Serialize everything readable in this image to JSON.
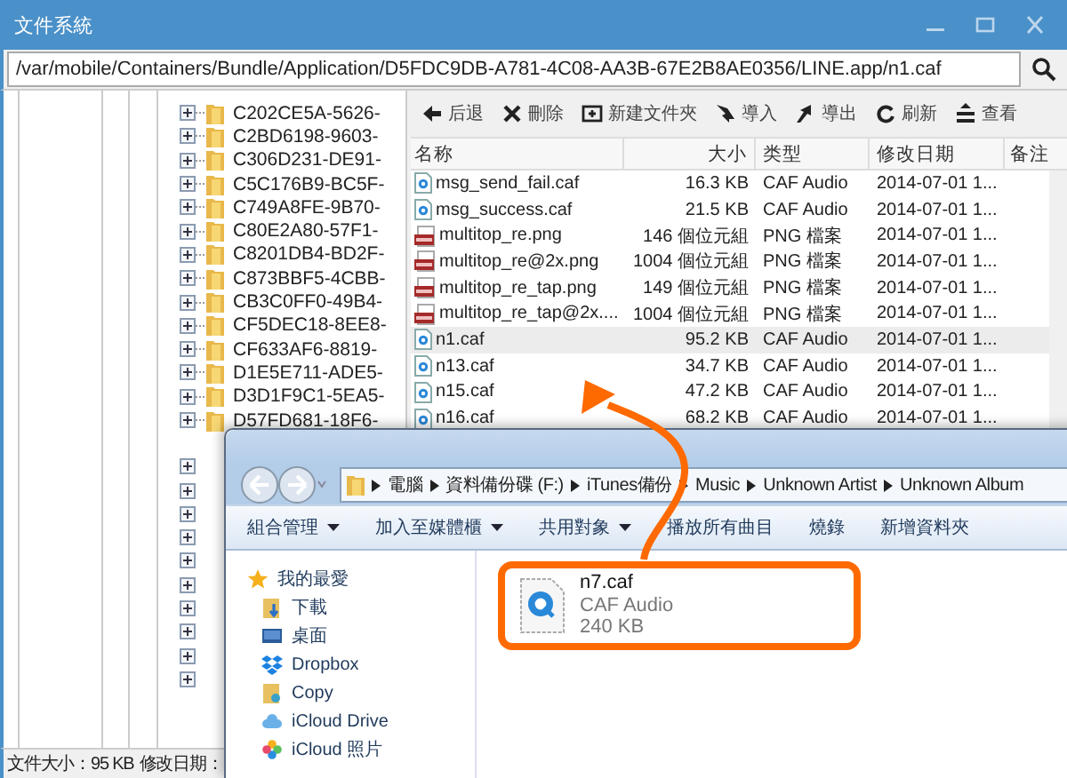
{
  "window": {
    "title": "文件系統"
  },
  "path": {
    "value": "/var/mobile/Containers/Bundle/Application/D5FDC9DB-A781-4C08-AA3B-67E2B8AE0356/LINE.app/n1.caf"
  },
  "tree": {
    "items": [
      {
        "label": "C202CE5A-5626-",
        "expanded": false
      },
      {
        "label": "C2BD6198-9603-",
        "expanded": false
      },
      {
        "label": "C306D231-DE91-",
        "expanded": false
      },
      {
        "label": "C5C176B9-BC5F-",
        "expanded": false
      },
      {
        "label": "C749A8FE-9B70-",
        "expanded": false
      },
      {
        "label": "C80E2A80-57F1-",
        "expanded": false
      },
      {
        "label": "C8201DB4-BD2F-",
        "expanded": false
      },
      {
        "label": "C873BBF5-4CBB-",
        "expanded": false
      },
      {
        "label": "CB3C0FF0-49B4-",
        "expanded": false
      },
      {
        "label": "CF5DEC18-8EE8-",
        "expanded": false
      },
      {
        "label": "CF633AF6-8819-",
        "expanded": false
      },
      {
        "label": "D1E5E711-ADE5-",
        "expanded": false
      },
      {
        "label": "D3D1F9C1-5EA5-",
        "expanded": false
      },
      {
        "label": "D57FD681-18F6-",
        "expanded": false
      }
    ]
  },
  "toolbar": [
    {
      "label": "后退",
      "kind": "back"
    },
    {
      "label": "刪除",
      "kind": "delete"
    },
    {
      "label": "新建文件夾",
      "kind": "newfolder"
    },
    {
      "label": "導入",
      "kind": "import"
    },
    {
      "label": "導出",
      "kind": "export"
    },
    {
      "label": "刷新",
      "kind": "refresh"
    },
    {
      "label": "查看",
      "kind": "view"
    }
  ],
  "table": {
    "columns": [
      "名称",
      "大小",
      "类型",
      "修改日期",
      "备注"
    ],
    "rows": [
      {
        "name": "msg_send_fail.caf",
        "size": "16.3 KB",
        "type": "CAF Audio",
        "modified": "2014-07-01 1...",
        "kind": "audio",
        "selected": false
      },
      {
        "name": "msg_success.caf",
        "size": "21.5 KB",
        "type": "CAF Audio",
        "modified": "2014-07-01 1...",
        "kind": "audio",
        "selected": false
      },
      {
        "name": "multitop_re.png",
        "size": "146 個位元組",
        "type": "PNG 檔案",
        "modified": "2014-07-01 1...",
        "kind": "image",
        "selected": false
      },
      {
        "name": "multitop_re@2x.png",
        "size": "1004 個位元組",
        "type": "PNG 檔案",
        "modified": "2014-07-01 1...",
        "kind": "image",
        "selected": false
      },
      {
        "name": "multitop_re_tap.png",
        "size": "149 個位元組",
        "type": "PNG 檔案",
        "modified": "2014-07-01 1...",
        "kind": "image",
        "selected": false
      },
      {
        "name": "multitop_re_tap@2x....",
        "size": "1004 個位元組",
        "type": "PNG 檔案",
        "modified": "2014-07-01 1...",
        "kind": "image",
        "selected": false
      },
      {
        "name": "n1.caf",
        "size": "95.2 KB",
        "type": "CAF Audio",
        "modified": "2014-07-01 1...",
        "kind": "audio",
        "selected": true
      },
      {
        "name": "n13.caf",
        "size": "34.7 KB",
        "type": "CAF Audio",
        "modified": "2014-07-01 1...",
        "kind": "audio",
        "selected": false
      },
      {
        "name": "n15.caf",
        "size": "47.2 KB",
        "type": "CAF Audio",
        "modified": "2014-07-01 1...",
        "kind": "audio",
        "selected": false
      },
      {
        "name": "n16.caf",
        "size": "68.2 KB",
        "type": "CAF Audio",
        "modified": "2014-07-01 1...",
        "kind": "audio",
        "selected": false
      }
    ]
  },
  "status_bar": {
    "file_size": "文件大小：95 KB",
    "modified": "修改日期："
  },
  "explorer": {
    "breadcrumb": [
      "電腦",
      "資料備份碟 (F:)",
      "iTunes備份",
      "Music",
      "Unknown Artist",
      "Unknown Album"
    ],
    "toolbar": [
      {
        "label": "組合管理",
        "dropdown": true
      },
      {
        "label": "加入至媒體櫃",
        "dropdown": true
      },
      {
        "label": "共用對象",
        "dropdown": true
      },
      {
        "label": "播放所有曲目",
        "dropdown": false
      },
      {
        "label": "燒錄",
        "dropdown": false
      },
      {
        "label": "新增資料夾",
        "dropdown": false
      }
    ],
    "sidebar": [
      {
        "label": "我的最愛",
        "kind": "favorites"
      },
      {
        "label": "下載",
        "kind": "downloads"
      },
      {
        "label": "桌面",
        "kind": "desktop"
      },
      {
        "label": "Dropbox",
        "kind": "dropbox"
      },
      {
        "label": "Copy",
        "kind": "copy"
      },
      {
        "label": "iCloud Drive",
        "kind": "icloud"
      },
      {
        "label": "iCloud 照片",
        "kind": "photos"
      }
    ],
    "file": {
      "name": "n7.caf",
      "type": "CAF Audio",
      "size": "240 KB"
    }
  }
}
